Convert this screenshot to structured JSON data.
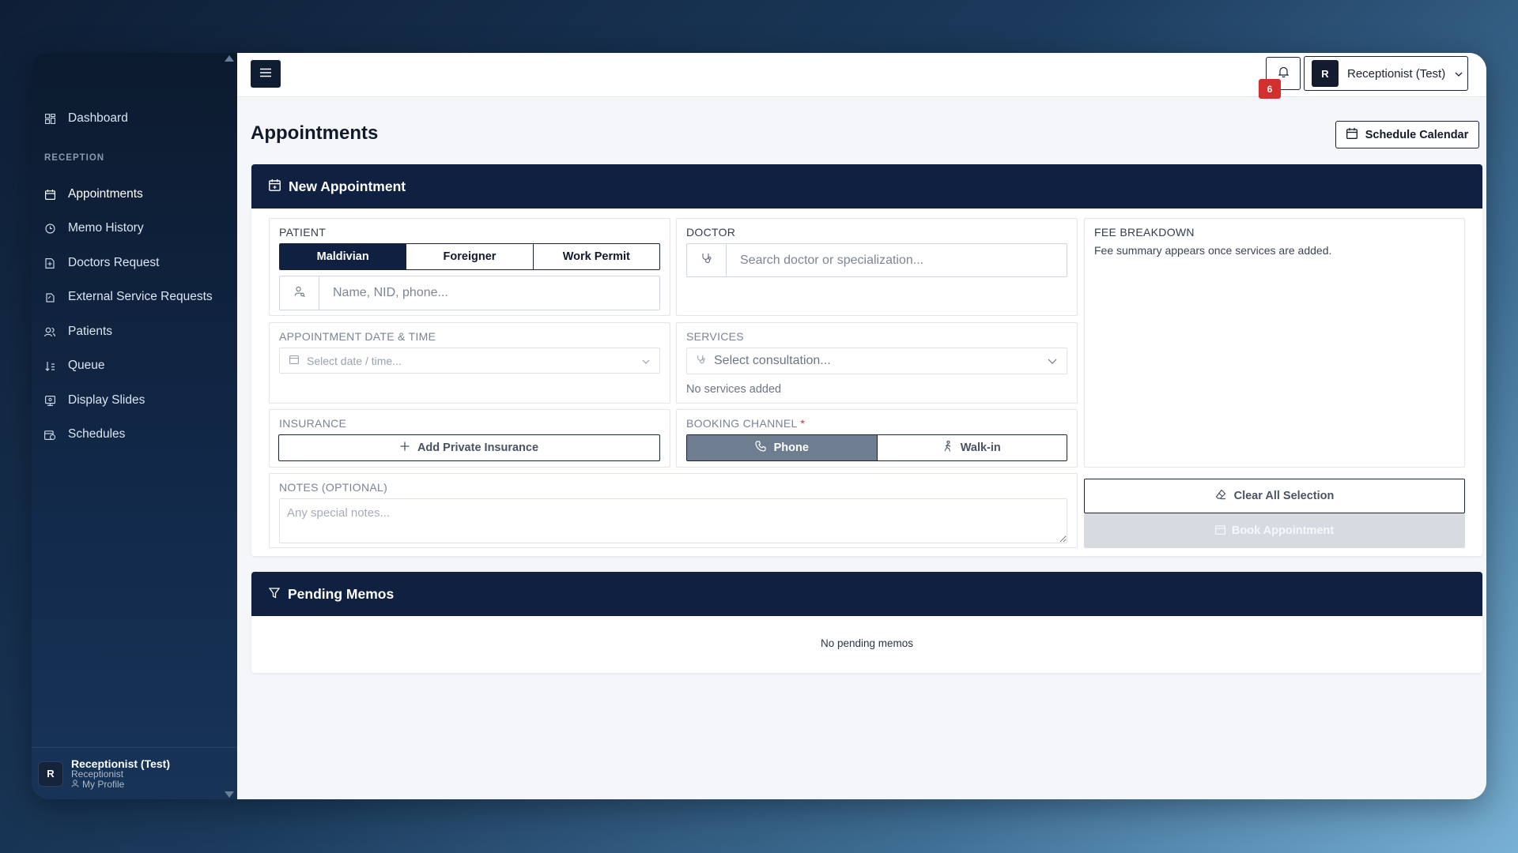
{
  "sidebar": {
    "nav_top": [
      {
        "label": "Dashboard",
        "icon": "dashboard-icon"
      }
    ],
    "section_label": "RECEPTION",
    "items": [
      {
        "label": "Appointments",
        "icon": "calendar-icon",
        "active": true
      },
      {
        "label": "Memo History",
        "icon": "history-icon"
      },
      {
        "label": "Doctors Request",
        "icon": "file-icon"
      },
      {
        "label": "External Service Requests",
        "icon": "external-icon"
      },
      {
        "label": "Patients",
        "icon": "users-icon"
      },
      {
        "label": "Queue",
        "icon": "queue-icon"
      },
      {
        "label": "Display Slides",
        "icon": "slides-icon"
      },
      {
        "label": "Schedules",
        "icon": "schedule-icon"
      }
    ],
    "user": {
      "avatar": "R",
      "name": "Receptionist (Test)",
      "role": "Receptionist",
      "profile_link": "My Profile"
    }
  },
  "topbar": {
    "notification_count": "6",
    "user_avatar": "R",
    "user_name": "Receptionist (Test)"
  },
  "page": {
    "title": "Appointments",
    "schedule_button": "Schedule Calendar"
  },
  "new_appointment": {
    "title": "New Appointment",
    "patient": {
      "label": "PATIENT",
      "types": [
        "Maldivian",
        "Foreigner",
        "Work Permit"
      ],
      "selected_type": "Maldivian",
      "search_placeholder": "Name, NID, phone..."
    },
    "doctor": {
      "label": "DOCTOR",
      "search_placeholder": "Search doctor or specialization..."
    },
    "fee": {
      "label": "FEE BREAKDOWN",
      "summary": "Fee summary appears once services are added."
    },
    "datetime": {
      "label": "APPOINTMENT DATE & TIME",
      "placeholder": "Select date / time..."
    },
    "services": {
      "label": "SERVICES",
      "placeholder": "Select consultation...",
      "empty_text": "No services added"
    },
    "insurance": {
      "label": "INSURANCE",
      "add_button": "Add Private Insurance"
    },
    "booking_channel": {
      "label": "BOOKING CHANNEL",
      "required_mark": "*",
      "options": [
        "Phone",
        "Walk-in"
      ],
      "selected": "Phone"
    },
    "notes": {
      "label": "NOTES (OPTIONAL)",
      "placeholder": "Any special notes..."
    },
    "clear_button": "Clear All Selection",
    "book_button": "Book Appointment"
  },
  "pending_memos": {
    "title": "Pending Memos",
    "empty_text": "No pending memos"
  }
}
